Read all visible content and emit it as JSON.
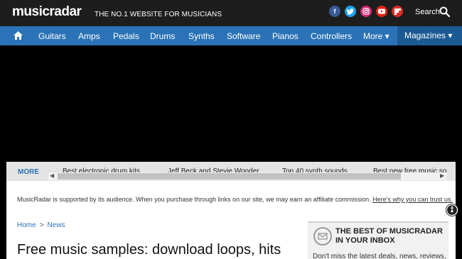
{
  "header": {
    "logo": "musicradar",
    "tagline": "THE NO.1 WEBSITE FOR MUSICIANS",
    "search_label": "Search",
    "socials": [
      {
        "name": "facebook",
        "glyph": "f",
        "color": "#3b5998"
      },
      {
        "name": "twitter",
        "glyph": "t",
        "color": "#1da1f2"
      },
      {
        "name": "instagram",
        "glyph": "◎",
        "color": "#d62976"
      },
      {
        "name": "youtube",
        "glyph": "▶",
        "color": "#e62117"
      },
      {
        "name": "flipboard",
        "glyph": "f",
        "color": "#e12828"
      }
    ]
  },
  "nav": {
    "items": [
      "Guitars",
      "Amps",
      "Pedals",
      "Drums",
      "Synths",
      "Software",
      "Pianos",
      "Controllers",
      "More ▾"
    ],
    "magazines": "Magazines ▾"
  },
  "trending": {
    "more_label": "MORE",
    "items": [
      "Best electronic drum kits",
      "Jeff Beck and Stevie Wonder",
      "Top 40 synth sounds",
      "Best new free music so"
    ]
  },
  "affiliate": {
    "text": "MusicRadar is supported by its audience. When you purchase through links on our site, we may earn an affiliate commission.",
    "link": "Here's why you can trust us."
  },
  "breadcrumb": {
    "home": "Home",
    "separator": ">",
    "section": "News"
  },
  "article": {
    "title": "Free music samples: download loops, hits"
  },
  "newsletter": {
    "title": "THE BEST OF MUSICRADAR IN YOUR INBOX",
    "text": "Don't miss the latest deals, news, reviews,"
  }
}
